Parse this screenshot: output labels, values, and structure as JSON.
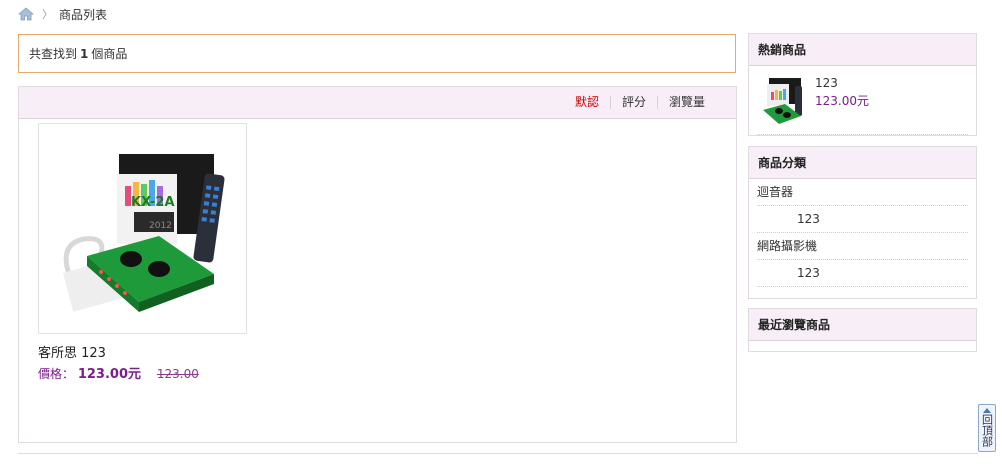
{
  "breadcrumb": {
    "home_icon": "home-icon",
    "separator": "〉",
    "current": "商品列表"
  },
  "result": {
    "prefix": "共查找到",
    "count": "1",
    "suffix": "個商品"
  },
  "sort": {
    "options": [
      "默認",
      "評分",
      "瀏覽量"
    ],
    "active": "默認"
  },
  "product": {
    "name": "客所思 123",
    "price_label": "價格：",
    "price": "123.00元",
    "old_price": "123.00"
  },
  "hot": {
    "title": "熱銷商品",
    "item": {
      "name": "123",
      "price": "123.00元"
    }
  },
  "categories": {
    "title": "商品分類",
    "items": [
      "迴音器",
      "123",
      "網路攝影機",
      "123"
    ]
  },
  "recent": {
    "title": "最近瀏覽商品"
  },
  "back_to_top": "回頂部",
  "colors": {
    "accent": "#c00000",
    "price": "#7b1d8a",
    "header_bg": "#f7eef7",
    "result_border": "#e4a96c"
  }
}
